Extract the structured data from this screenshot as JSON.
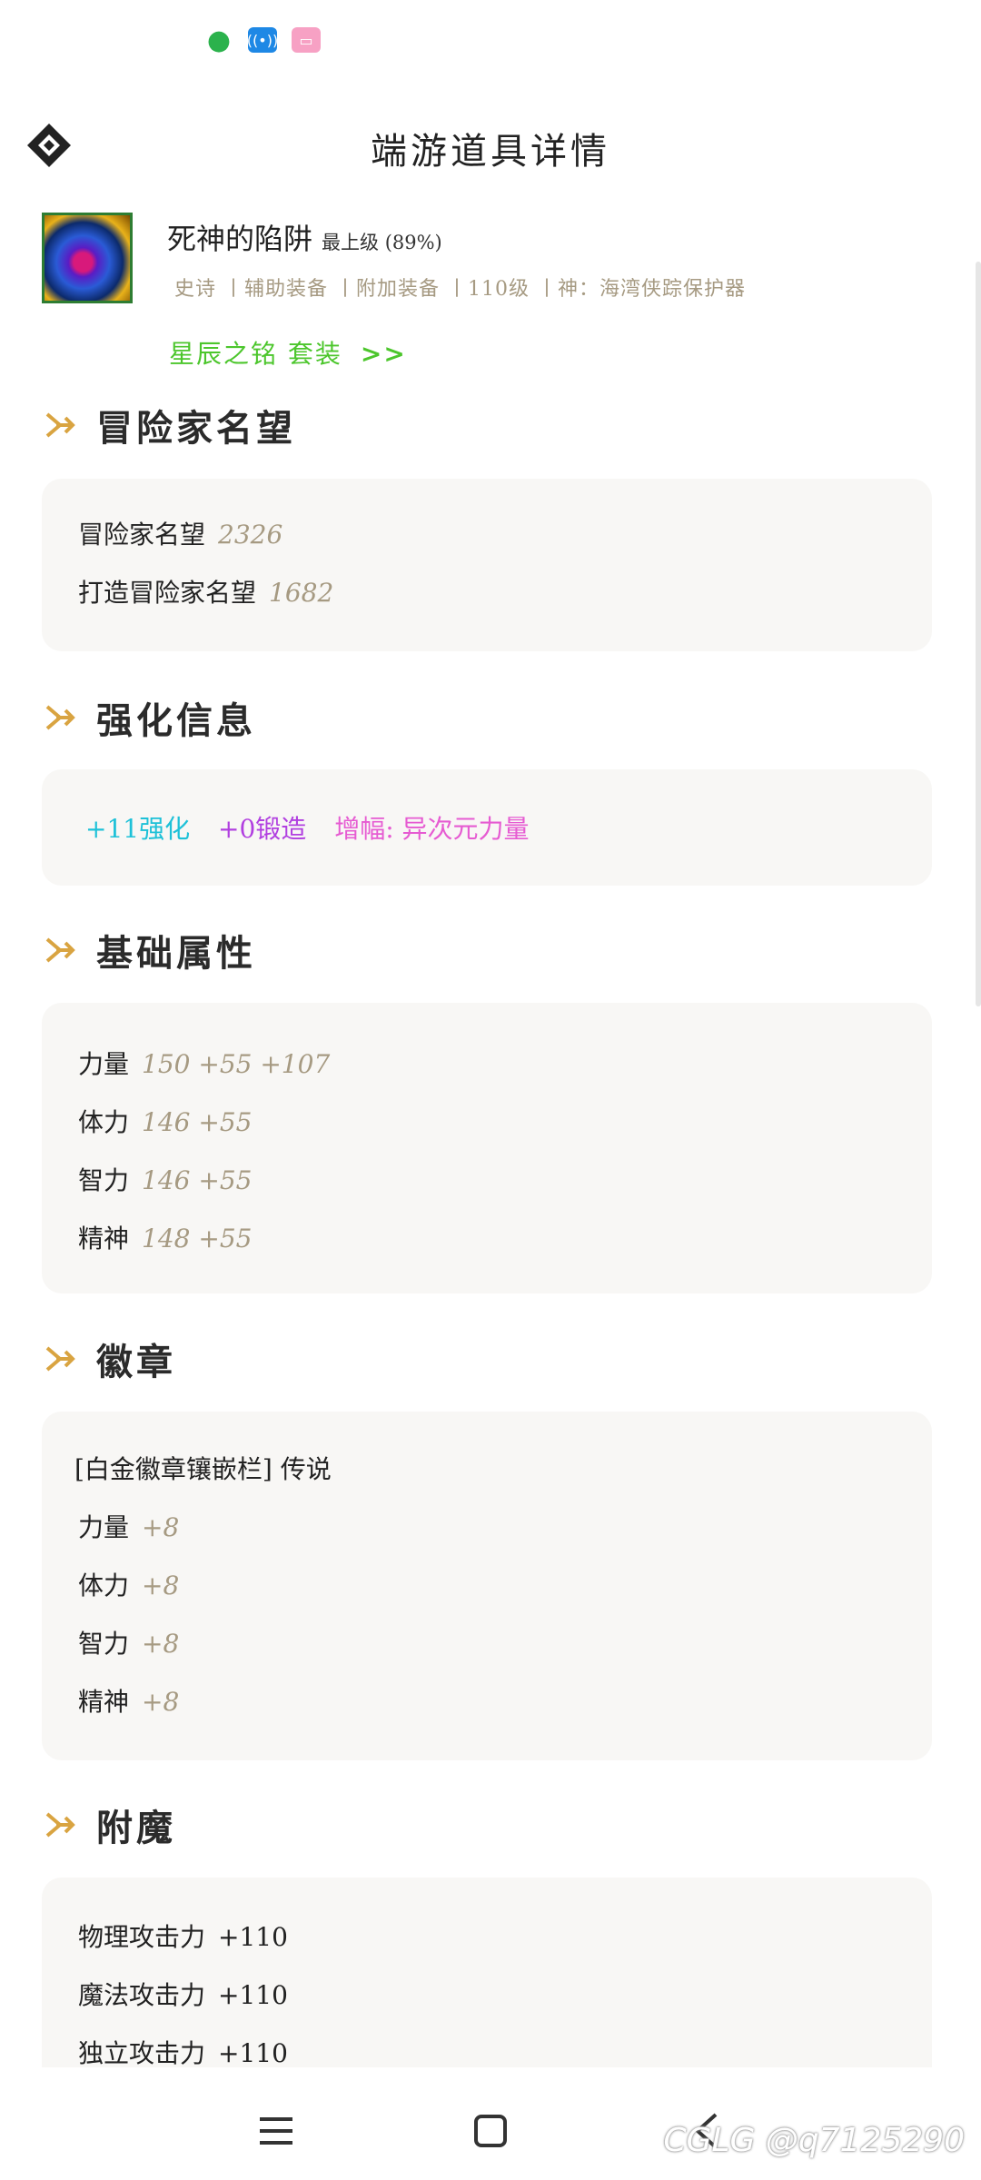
{
  "status_icons": [
    "wechat-icon",
    "hotspot-icon",
    "bilibili-icon"
  ],
  "header": {
    "title": "端游道具详情"
  },
  "item": {
    "name": "死神的陷阱",
    "grade": "最上级 (89%)",
    "meta": "史诗 丨辅助装备 丨附加装备 丨110级 丨神：海湾侠踪保护器",
    "set_label": "星辰之铭 套装",
    "set_chevron": ">>"
  },
  "sections": {
    "fame": {
      "title": "冒险家名望",
      "rows": [
        {
          "label": "冒险家名望",
          "value": "2326"
        },
        {
          "label": "打造冒险家名望",
          "value": "1682"
        }
      ]
    },
    "enhance": {
      "title": "强化信息",
      "reinforce": "+11强化",
      "forge": "+0锻造",
      "amplify": "增幅: 异次元力量"
    },
    "base": {
      "title": "基础属性",
      "rows": [
        {
          "label": "力量",
          "value": "150 +55 +107"
        },
        {
          "label": "体力",
          "value": "146 +55"
        },
        {
          "label": "智力",
          "value": "146 +55"
        },
        {
          "label": "精神",
          "value": "148 +55"
        }
      ]
    },
    "emblem": {
      "title": "徽章",
      "header": "[白金徽章镶嵌栏] 传说",
      "rows": [
        {
          "label": "力量",
          "value": "+8"
        },
        {
          "label": "体力",
          "value": "+8"
        },
        {
          "label": "智力",
          "value": "+8"
        },
        {
          "label": "精神",
          "value": "+8"
        }
      ]
    },
    "enchant": {
      "title": "附魔",
      "rows": [
        {
          "label": "物理攻击力",
          "value": "+110"
        },
        {
          "label": "魔法攻击力",
          "value": "+110"
        },
        {
          "label": "独立攻击力",
          "value": "+110"
        }
      ]
    }
  },
  "watermark": "CGLG @q7125290",
  "colors": {
    "value_text": "#a69a82",
    "set_green": "#4cc62c",
    "reinforce_cyan": "#1ec1d8",
    "forge_purple": "#b13fe0",
    "amplify_pink": "#e65bd2",
    "section_arrow": "#d9a441",
    "card_bg": "#f8f7f5"
  }
}
